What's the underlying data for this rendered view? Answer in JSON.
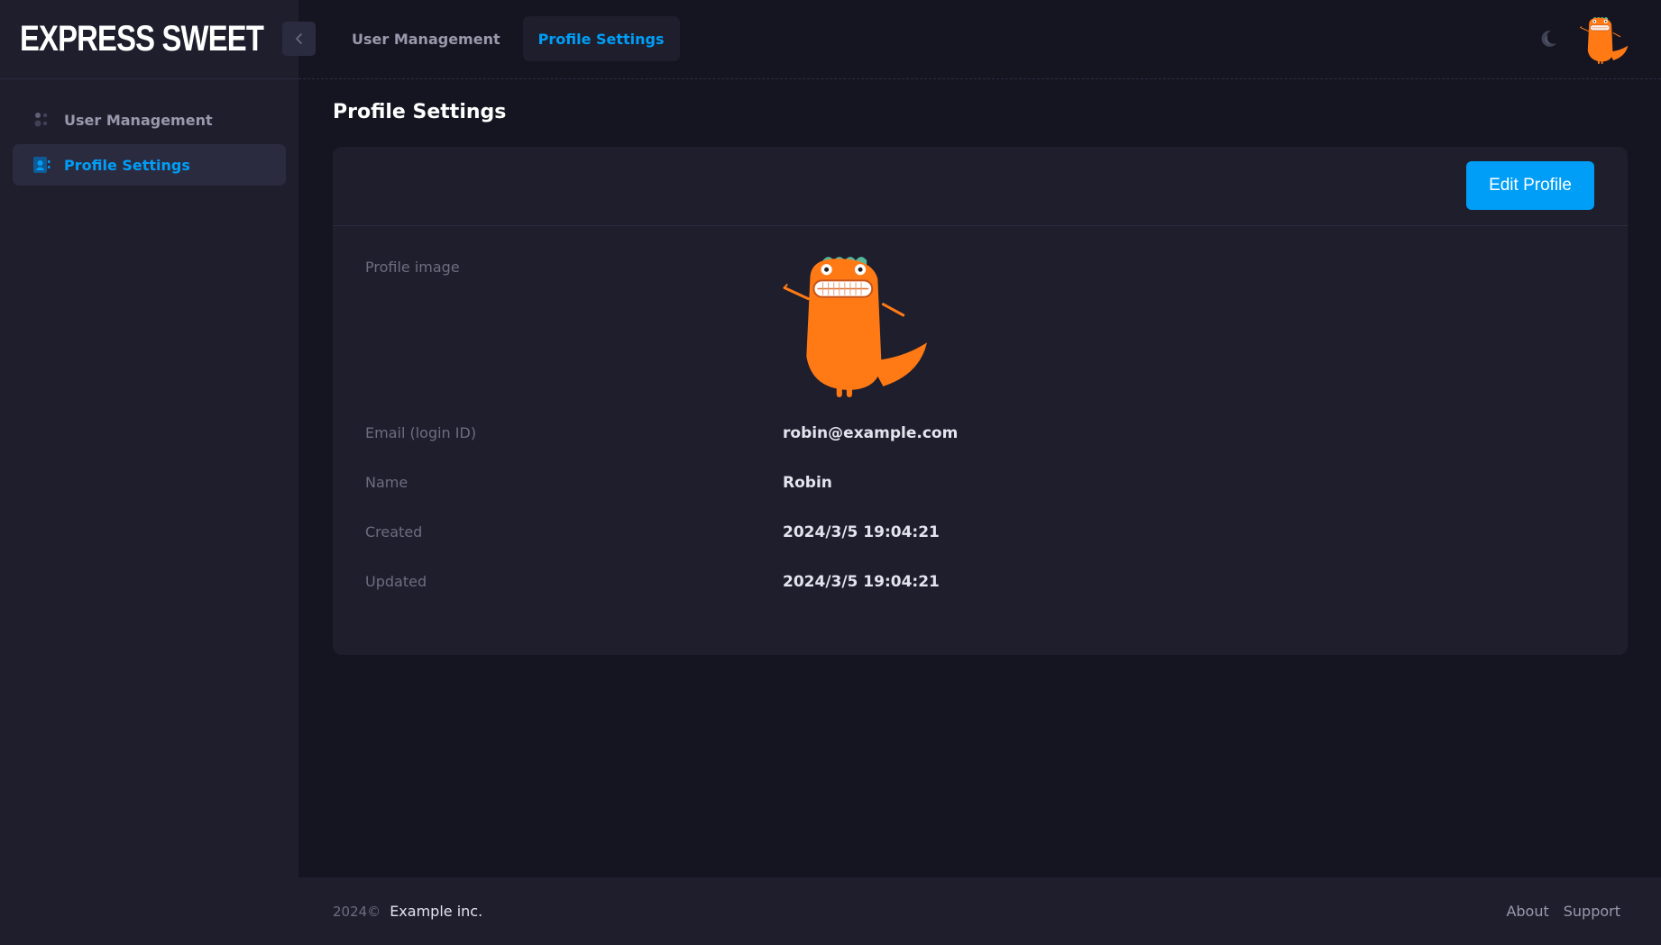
{
  "app": {
    "brand": "EXPRESS SWEET"
  },
  "colors": {
    "accent": "#009ef7",
    "bg": "#151521",
    "panel": "#1e1e2d",
    "mascot": "#ff7a15"
  },
  "sidebar": {
    "items": [
      {
        "label": "User Management",
        "icon": "users-icon",
        "active": false
      },
      {
        "label": "Profile Settings",
        "icon": "profile-card-icon",
        "active": true
      }
    ]
  },
  "header": {
    "tabs": [
      {
        "label": "User Management",
        "active": false
      },
      {
        "label": "Profile Settings",
        "active": true
      }
    ],
    "theme_icon": "moon-icon",
    "avatar_icon": "dinosaur-avatar-icon"
  },
  "main": {
    "title": "Profile Settings",
    "edit_button": "Edit Profile",
    "fields": {
      "profile_image": {
        "label": "Profile image"
      },
      "email": {
        "label": "Email (login ID)",
        "value": "robin@example.com"
      },
      "name": {
        "label": "Name",
        "value": "Robin"
      },
      "created": {
        "label": "Created",
        "value": "2024/3/5 19:04:21"
      },
      "updated": {
        "label": "Updated",
        "value": "2024/3/5 19:04:21"
      }
    }
  },
  "footer": {
    "year": "2024©",
    "company": "Example inc.",
    "links": [
      "About",
      "Support"
    ]
  }
}
